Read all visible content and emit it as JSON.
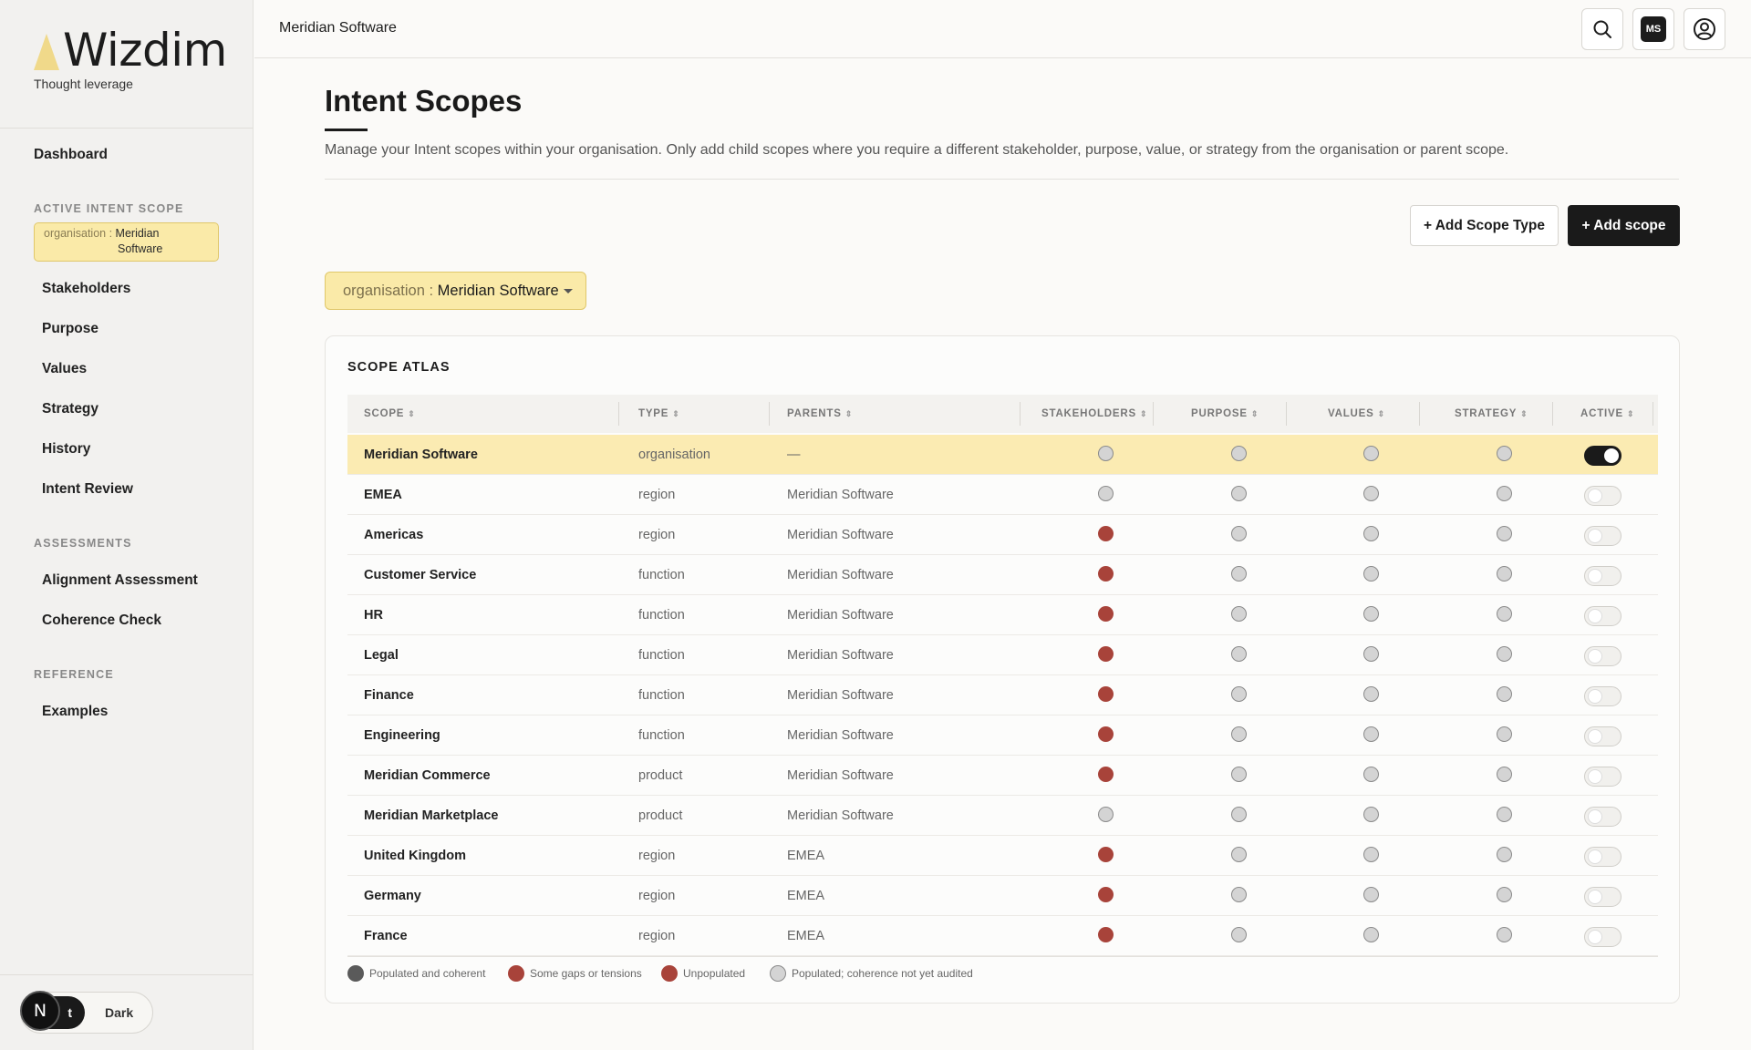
{
  "brand": {
    "name": "Wizdim",
    "tagline": "Thought leverage"
  },
  "sidebar": {
    "dashboard": "Dashboard",
    "active_scope_heading": "ACTIVE INTENT SCOPE",
    "active_scope_type": "organisation :",
    "active_scope_name_1": "Meridian",
    "active_scope_name_2": "Software",
    "scope_items": [
      "Stakeholders",
      "Purpose",
      "Values",
      "Strategy",
      "History",
      "Intent Review"
    ],
    "assessments_heading": "ASSESSMENTS",
    "assessments": [
      "Alignment Assessment",
      "Coherence Check"
    ],
    "reference_heading": "REFERENCE",
    "reference": [
      "Examples"
    ],
    "theme": {
      "light": "t",
      "dark": "Dark",
      "badge": "N"
    }
  },
  "topbar": {
    "org_name": "Meridian Software",
    "user_initials": "MS"
  },
  "page": {
    "title": "Intent Scopes",
    "description": "Manage your Intent scopes within your organisation. Only add child scopes where you require a different stakeholder, purpose, value, or strategy from the organisation or parent scope.",
    "add_scope_type": "+ Add Scope Type",
    "add_scope": "+ Add scope",
    "scope_selector": {
      "type": "organisation :",
      "name": "Meridian Software"
    }
  },
  "atlas": {
    "title": "SCOPE ATLAS",
    "columns": [
      "SCOPE",
      "TYPE",
      "PARENTS",
      "STAKEHOLDERS",
      "PURPOSE",
      "VALUES",
      "STRATEGY",
      "ACTIVE"
    ],
    "rows": [
      {
        "scope": "Meridian Software",
        "type": "organisation",
        "parents": "—",
        "stakeholders": "populated",
        "purpose": "populated",
        "values": "populated",
        "strategy": "populated",
        "active": true
      },
      {
        "scope": "EMEA",
        "type": "region",
        "parents": "Meridian Software",
        "stakeholders": "populated",
        "purpose": "populated",
        "values": "populated",
        "strategy": "populated",
        "active": false
      },
      {
        "scope": "Americas",
        "type": "region",
        "parents": "Meridian Software",
        "stakeholders": "unpopulated",
        "purpose": "populated",
        "values": "populated",
        "strategy": "populated",
        "active": false
      },
      {
        "scope": "Customer Service",
        "type": "function",
        "parents": "Meridian Software",
        "stakeholders": "unpopulated",
        "purpose": "populated",
        "values": "populated",
        "strategy": "populated",
        "active": false
      },
      {
        "scope": "HR",
        "type": "function",
        "parents": "Meridian Software",
        "stakeholders": "unpopulated",
        "purpose": "populated",
        "values": "populated",
        "strategy": "populated",
        "active": false
      },
      {
        "scope": "Legal",
        "type": "function",
        "parents": "Meridian Software",
        "stakeholders": "unpopulated",
        "purpose": "populated",
        "values": "populated",
        "strategy": "populated",
        "active": false
      },
      {
        "scope": "Finance",
        "type": "function",
        "parents": "Meridian Software",
        "stakeholders": "unpopulated",
        "purpose": "populated",
        "values": "populated",
        "strategy": "populated",
        "active": false
      },
      {
        "scope": "Engineering",
        "type": "function",
        "parents": "Meridian Software",
        "stakeholders": "unpopulated",
        "purpose": "populated",
        "values": "populated",
        "strategy": "populated",
        "active": false
      },
      {
        "scope": "Meridian Commerce",
        "type": "product",
        "parents": "Meridian Software",
        "stakeholders": "unpopulated",
        "purpose": "populated",
        "values": "populated",
        "strategy": "populated",
        "active": false
      },
      {
        "scope": "Meridian Marketplace",
        "type": "product",
        "parents": "Meridian Software",
        "stakeholders": "populated",
        "purpose": "populated",
        "values": "populated",
        "strategy": "populated",
        "active": false
      },
      {
        "scope": "United Kingdom",
        "type": "region",
        "parents": "EMEA",
        "stakeholders": "unpopulated",
        "purpose": "populated",
        "values": "populated",
        "strategy": "populated",
        "active": false
      },
      {
        "scope": "Germany",
        "type": "region",
        "parents": "EMEA",
        "stakeholders": "unpopulated",
        "purpose": "populated",
        "values": "populated",
        "strategy": "populated",
        "active": false
      },
      {
        "scope": "France",
        "type": "region",
        "parents": "EMEA",
        "stakeholders": "unpopulated",
        "purpose": "populated",
        "values": "populated",
        "strategy": "populated",
        "active": false
      }
    ],
    "legend": [
      {
        "label": "Populated and coherent",
        "color": "#5a5a5a"
      },
      {
        "label": "Some gaps or tensions",
        "color": "#a8433a"
      },
      {
        "label": "Unpopulated",
        "color": "#a8433a"
      },
      {
        "label": "Populated; coherence not yet audited",
        "color": "#d4d4d4"
      }
    ]
  },
  "colors": {
    "accent": "#faeaa8",
    "accent_border": "#e0c76a",
    "status_red": "#a8433a",
    "dark": "#1a1a1a"
  }
}
